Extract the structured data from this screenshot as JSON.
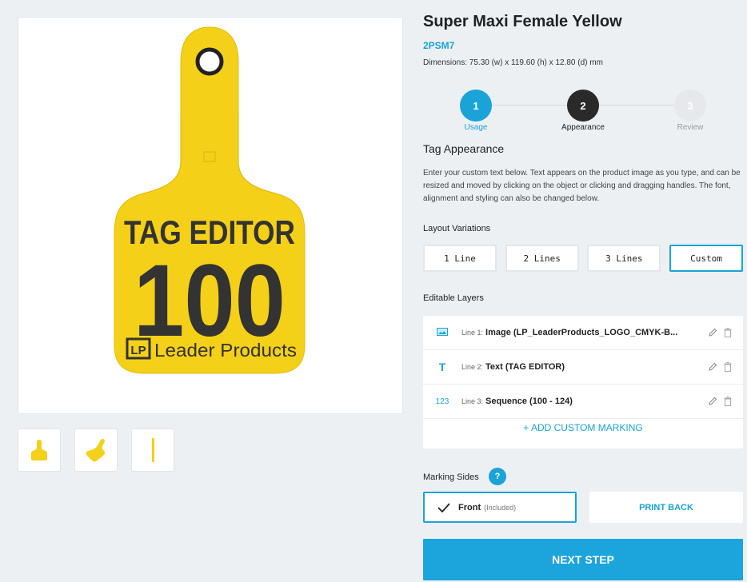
{
  "product": {
    "title": "Super Maxi Female Yellow",
    "sku": "2PSM7",
    "dimensions": "Dimensions: 75.30 (w) x 119.60 (h) x 12.80 (d) mm"
  },
  "tag_preview": {
    "line_top": "TAG EDITOR",
    "line_number": "100",
    "logo_text": "Leader Products",
    "logo_mark": "LP",
    "tag_color": "#f4d019",
    "text_color": "#333333"
  },
  "thumbnails": [
    {
      "name": "front-view"
    },
    {
      "name": "angle-view"
    },
    {
      "name": "side-view"
    }
  ],
  "stepper": {
    "steps": [
      {
        "number": "1",
        "label": "Usage",
        "state": "active"
      },
      {
        "number": "2",
        "label": "Appearance",
        "state": "current"
      },
      {
        "number": "3",
        "label": "Review",
        "state": "upcoming"
      }
    ]
  },
  "appearance": {
    "heading": "Tag Appearance",
    "description": "Enter your custom text below. Text appears on the product image as you type, and can be resized and moved by clicking on the object or clicking and dragging handles. The font, alignment and styling can also be changed below."
  },
  "layout_variations": {
    "label": "Layout Variations",
    "options": [
      "1 Line",
      "2 Lines",
      "3 Lines",
      "Custom"
    ],
    "selected": "Custom"
  },
  "editable_layers": {
    "label": "Editable Layers",
    "layers": [
      {
        "icon": "image-icon",
        "prefix": "Line 1:",
        "value": "Image (LP_LeaderProducts_LOGO_CMYK-B..."
      },
      {
        "icon": "text-icon",
        "icon_text": "T",
        "prefix": "Line 2:",
        "value": "Text (TAG EDITOR)"
      },
      {
        "icon": "sequence-icon",
        "icon_text": "123",
        "prefix": "Line 3:",
        "value": "Sequence (100 - 124)"
      }
    ],
    "add_label": "+ ADD CUSTOM MARKING"
  },
  "marking_sides": {
    "label": "Marking Sides",
    "help": "?",
    "front_label": "Front",
    "front_note": "(Included)",
    "back_label": "PRINT BACK"
  },
  "next_button": "NEXT STEP",
  "colors": {
    "accent": "#1aa3d9",
    "dark_step": "#2a2a2a",
    "inactive_step": "#e6e8eb"
  }
}
